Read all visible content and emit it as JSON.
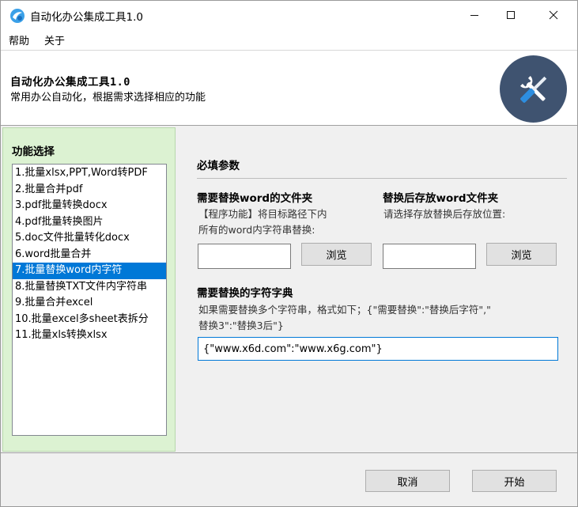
{
  "window": {
    "title": "自动化办公集成工具1.0",
    "icons": {
      "app": "app-logo-icon",
      "minimize": "minimize-icon",
      "maximize": "maximize-icon",
      "close": "close-icon"
    }
  },
  "menu": {
    "help": "帮助",
    "about": "关于"
  },
  "header": {
    "title": "自动化办公集成工具1.0",
    "subtitle": "常用办公自动化，根据需求选择相应的功能",
    "logo_icon": "tools-icon",
    "logo_color": "#3f5370"
  },
  "sidebar": {
    "title": "功能选择",
    "selected_index": 6,
    "items": [
      "1.批量xlsx,PPT,Word转PDF",
      "2.批量合并pdf",
      "3.pdf批量转换docx",
      "4.pdf批量转换图片",
      "5.doc文件批量转化docx",
      "6.word批量合并",
      "7.批量替换word内字符",
      "8.批量替换TXT文件内字符串",
      "9.批量合并excel",
      "10.批量excel多sheet表拆分",
      "11.批量xls转换xlsx"
    ]
  },
  "main": {
    "section_title": "必填参数",
    "source_folder": {
      "label": "需要替换word的文件夹",
      "desc_line1": "【程序功能】将目标路径下内",
      "desc_line2": "所有的word内字符串替换:",
      "value": "",
      "browse_label": "浏览"
    },
    "output_folder": {
      "label": "替换后存放word文件夹",
      "desc": "请选择存放替换后存放位置:",
      "value": "",
      "browse_label": "浏览"
    },
    "dict": {
      "label": "需要替换的字符字典",
      "desc_line1": "如果需要替换多个字符串，格式如下；{\"需要替换\":\"替换后字符\",\"",
      "desc_line2": "替换3\":\"替换3后\"}",
      "value": "{\"www.x6d.com\":\"www.x6g.com\"}"
    }
  },
  "footer": {
    "cancel_label": "取消",
    "start_label": "开始"
  },
  "colors": {
    "accent": "#0078d7",
    "sidebar_bg": "#dcf2d2"
  }
}
